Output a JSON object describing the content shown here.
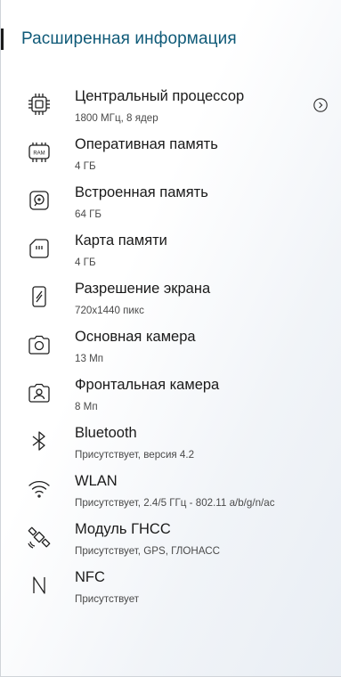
{
  "header": {
    "title": "Расширенная информация"
  },
  "items": [
    {
      "icon": "cpu-icon",
      "label": "Центральный процессор",
      "value": "1800 МГц, 8 ядер",
      "has_chevron": true
    },
    {
      "icon": "ram-icon",
      "ram_text": "RAM",
      "label": "Оперативная память",
      "value": "4 ГБ"
    },
    {
      "icon": "storage-icon",
      "label": "Встроенная память",
      "value": "64 ГБ"
    },
    {
      "icon": "sd-card-icon",
      "label": "Карта памяти",
      "value": "4 ГБ"
    },
    {
      "icon": "screen-resolution-icon",
      "label": "Разрешение экрана",
      "value": "720x1440 пикс"
    },
    {
      "icon": "camera-icon",
      "label": "Основная камера",
      "value": "13 Мп"
    },
    {
      "icon": "front-camera-icon",
      "label": "Фронтальная камера",
      "value": "8 Мп"
    },
    {
      "icon": "bluetooth-icon",
      "label": "Bluetooth",
      "value": "Присутствует, версия 4.2"
    },
    {
      "icon": "wifi-icon",
      "label": "WLAN",
      "value": "Присутствует, 2.4/5 ГГц - 802.11 a/b/g/n/ac"
    },
    {
      "icon": "satellite-icon",
      "label": "Модуль ГНСС",
      "value": "Присутствует, GPS, ГЛОНАСС"
    },
    {
      "icon": "nfc-icon",
      "label": "NFC",
      "value": "Присутствует"
    }
  ],
  "colors": {
    "title": "#0f5a78",
    "label": "#1a1a1a",
    "value": "#4a4a4a"
  }
}
